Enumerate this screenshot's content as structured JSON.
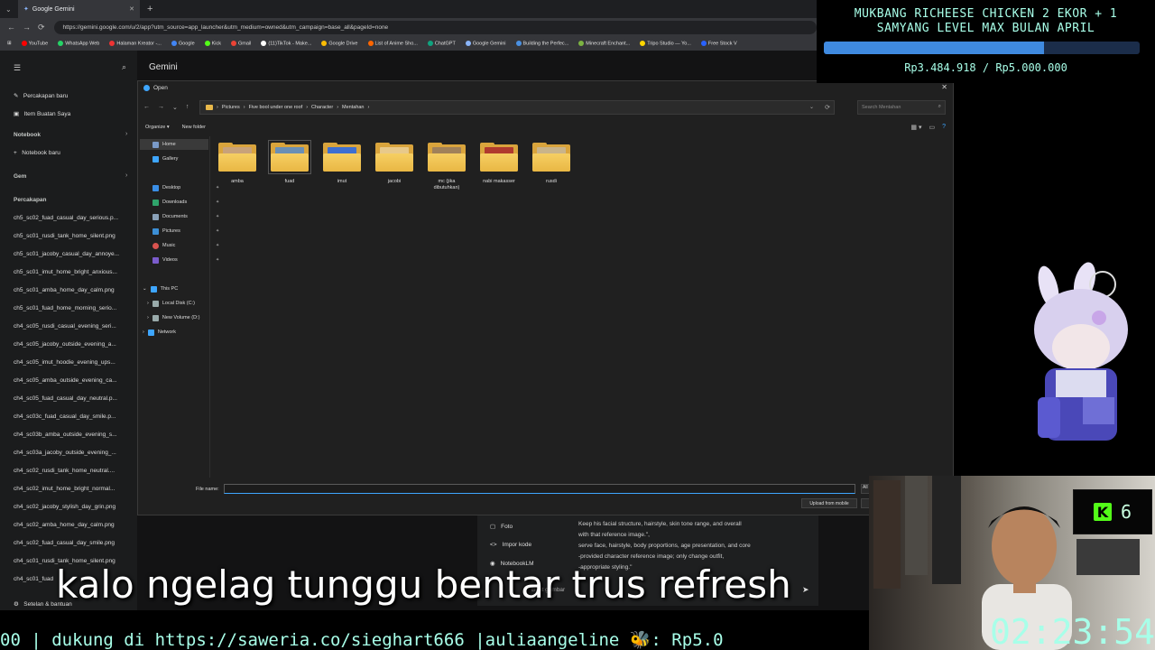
{
  "browser": {
    "tab_title": "Google Gemini",
    "url": "https://gemini.google.com/u/2/app?utm_source=app_launcher&utm_medium=owned&utm_campaign=base_all&pageId=none",
    "bookmarks": [
      "YouTube",
      "WhatsApp Web",
      "Halaman Kreator -...",
      "Google",
      "Kick",
      "Gmail",
      "(11)TikTok - Make...",
      "Google Drive",
      "List of Anime Sho...",
      "ChatGPT",
      "Google Gemini",
      "Building the Perfec...",
      "Minecraft Enchant...",
      "Tripo Studio — Yo...",
      "Free Stock V"
    ]
  },
  "gemini": {
    "title": "Gemini",
    "new_chat": "Percakapan baru",
    "my_items": "Item Buatan Saya",
    "notebook_header": "Notebook",
    "new_notebook": "Notebook baru",
    "gem_header": "Gem",
    "chats_header": "Percakapan",
    "chats": [
      "ch5_sc02_fuad_casual_day_serious.p...",
      "ch5_sc01_rusdi_tank_home_silent.png",
      "ch5_sc01_jacoby_casual_day_annoye...",
      "ch5_sc01_imut_home_bright_anxious...",
      "ch5_sc01_amba_home_day_calm.png",
      "ch5_sc01_fuad_home_morning_serio...",
      "ch4_sc05_rusdi_casual_evening_seri...",
      "ch4_sc05_jacoby_outside_evening_a...",
      "ch4_sc05_imut_hoodie_evening_ups...",
      "ch4_sc05_amba_outside_evening_ca...",
      "ch4_sc05_fuad_casual_day_neutral.p...",
      "ch4_sc03c_fuad_casual_day_smile.p...",
      "ch4_sc03b_amba_outside_evening_s...",
      "ch4_sc03a_jacoby_outside_evening_...",
      "ch4_sc02_rusdi_tank_home_neutral....",
      "ch4_sc02_imut_home_bright_normal...",
      "ch4_sc02_jacoby_stylish_day_grin.png",
      "ch4_sc02_amba_home_day_calm.png",
      "ch4_sc02_fuad_casual_day_smile.png",
      "ch4_sc01_rusdi_tank_home_silent.png",
      "ch4_sc01_fuad"
    ],
    "settings": "Setelan & bantuan",
    "menu": {
      "items": [
        "Foto",
        "Impor kode",
        "NotebookLM"
      ],
      "text_lines": [
        "Keep his facial structure, hairstyle, skin tone range, and overall",
        "with that reference image.\",",
        "serve face, hairstyle, body proportions, age presentation, and core",
        "-provided character reference image; only change outfit,",
        "-appropriate styling.\""
      ],
      "extra": "Buat gambar"
    }
  },
  "dialog": {
    "title": "Open",
    "breadcrumb": [
      "Pictures",
      "Five bool under one roof",
      "Character",
      "Mentahan"
    ],
    "search_placeholder": "Search Mentahan",
    "organize": "Organize",
    "new_folder": "New folder",
    "nav": {
      "home": "Home",
      "gallery": "Gallery",
      "quick": [
        "Desktop",
        "Downloads",
        "Documents",
        "Pictures",
        "Music",
        "Videos"
      ],
      "this_pc": "This PC",
      "drives": [
        "Local Disk (C:)",
        "New Volume (D:)"
      ],
      "network": "Network"
    },
    "folders": [
      {
        "name": "amba",
        "color": "#c8a27a"
      },
      {
        "name": "fuad",
        "color": "#6a8fb5"
      },
      {
        "name": "imut",
        "color": "#3e6fd1"
      },
      {
        "name": "jacobi",
        "color": "#e8c98a"
      },
      {
        "name": "mc (jika dibutuhkan)",
        "color": "#a0815a"
      },
      {
        "name": "nabi makasser",
        "color": "#b03a2e"
      },
      {
        "name": "rusdi",
        "color": "#c9b48a"
      }
    ],
    "selected_folder": "fuad",
    "file_name_label": "File name:",
    "file_name_value": "",
    "file_type": "All",
    "upload_from_mobile": "Upload from mobile"
  },
  "overlay": {
    "donation_title_1": "MUKBANG RICHEESE CHICKEN 2 EKOR + 1",
    "donation_title_2": "SAMYANG LEVEL MAX BULAN APRIL",
    "donation_progress": 0.697,
    "donation_amount": "Rp3.484.918 / Rp5.000.000",
    "kick_count": "6",
    "timer": "02:23:54",
    "subtitle": "kalo ngelag tunggu bentar trus refresh",
    "ticker": "00 |  dukung di https://saweria.co/sieghart666 |auliaangeline 🐝: Rp5.0"
  },
  "colors": {
    "accent": "#a8ffe9",
    "bar_fill": "#3f8ae0",
    "kick": "#53fc18",
    "folder": "#e9b744"
  }
}
